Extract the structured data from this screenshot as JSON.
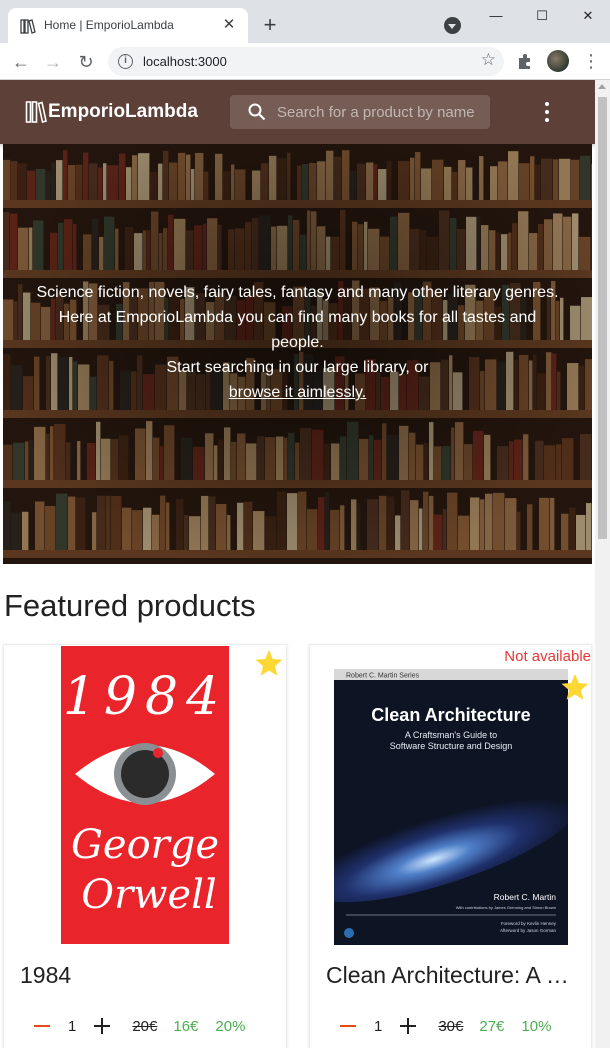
{
  "browser": {
    "tab_title": "Home | EmporioLambda",
    "url": "localhost:3000"
  },
  "app": {
    "brand": "EmporioLambda",
    "search_placeholder": "Search for a product by name"
  },
  "hero": {
    "line1": "Science fiction, novels, fairy tales, fantasy and many other literary genres.",
    "line2": "Here at EmporioLambda you can find many books for all tastes and people.",
    "line3": "Start searching in our large library, or",
    "link": "browse it aimlessly."
  },
  "featured": {
    "title": "Featured products",
    "products": [
      {
        "name": "1984",
        "cover_text": [
          "1984",
          "George",
          "Orwell"
        ],
        "quantity": "1",
        "old_price": "20€",
        "price": "16€",
        "discount": "20%",
        "available": true,
        "favorite_icon": "star-icon"
      },
      {
        "name": "Clean Architecture: A Craftsman's Guide to Software Structure and Design",
        "cover_series": "Robert C. Martin Series",
        "cover_title": "Clean Architecture",
        "cover_subtitle_1": "A Craftsman's Guide to",
        "cover_subtitle_2": "Software Structure and Design",
        "cover_author": "Robert C. Martin",
        "cover_contrib": "With contributions by James Grenning and Simon Brown",
        "cover_foreword": "Foreword by Kevlin Henney",
        "cover_afterword": "Afterword by Jason Gorman",
        "status": "Not available",
        "quantity": "1",
        "old_price": "30€",
        "price": "27€",
        "discount": "10%",
        "available": false,
        "favorite_icon": "star-icon"
      }
    ]
  },
  "colors": {
    "appbar": "#5d4037",
    "accent_discount": "#4caf50",
    "unavailable": "#e53935",
    "star": "#fdd835",
    "minus": "#e64a19"
  }
}
